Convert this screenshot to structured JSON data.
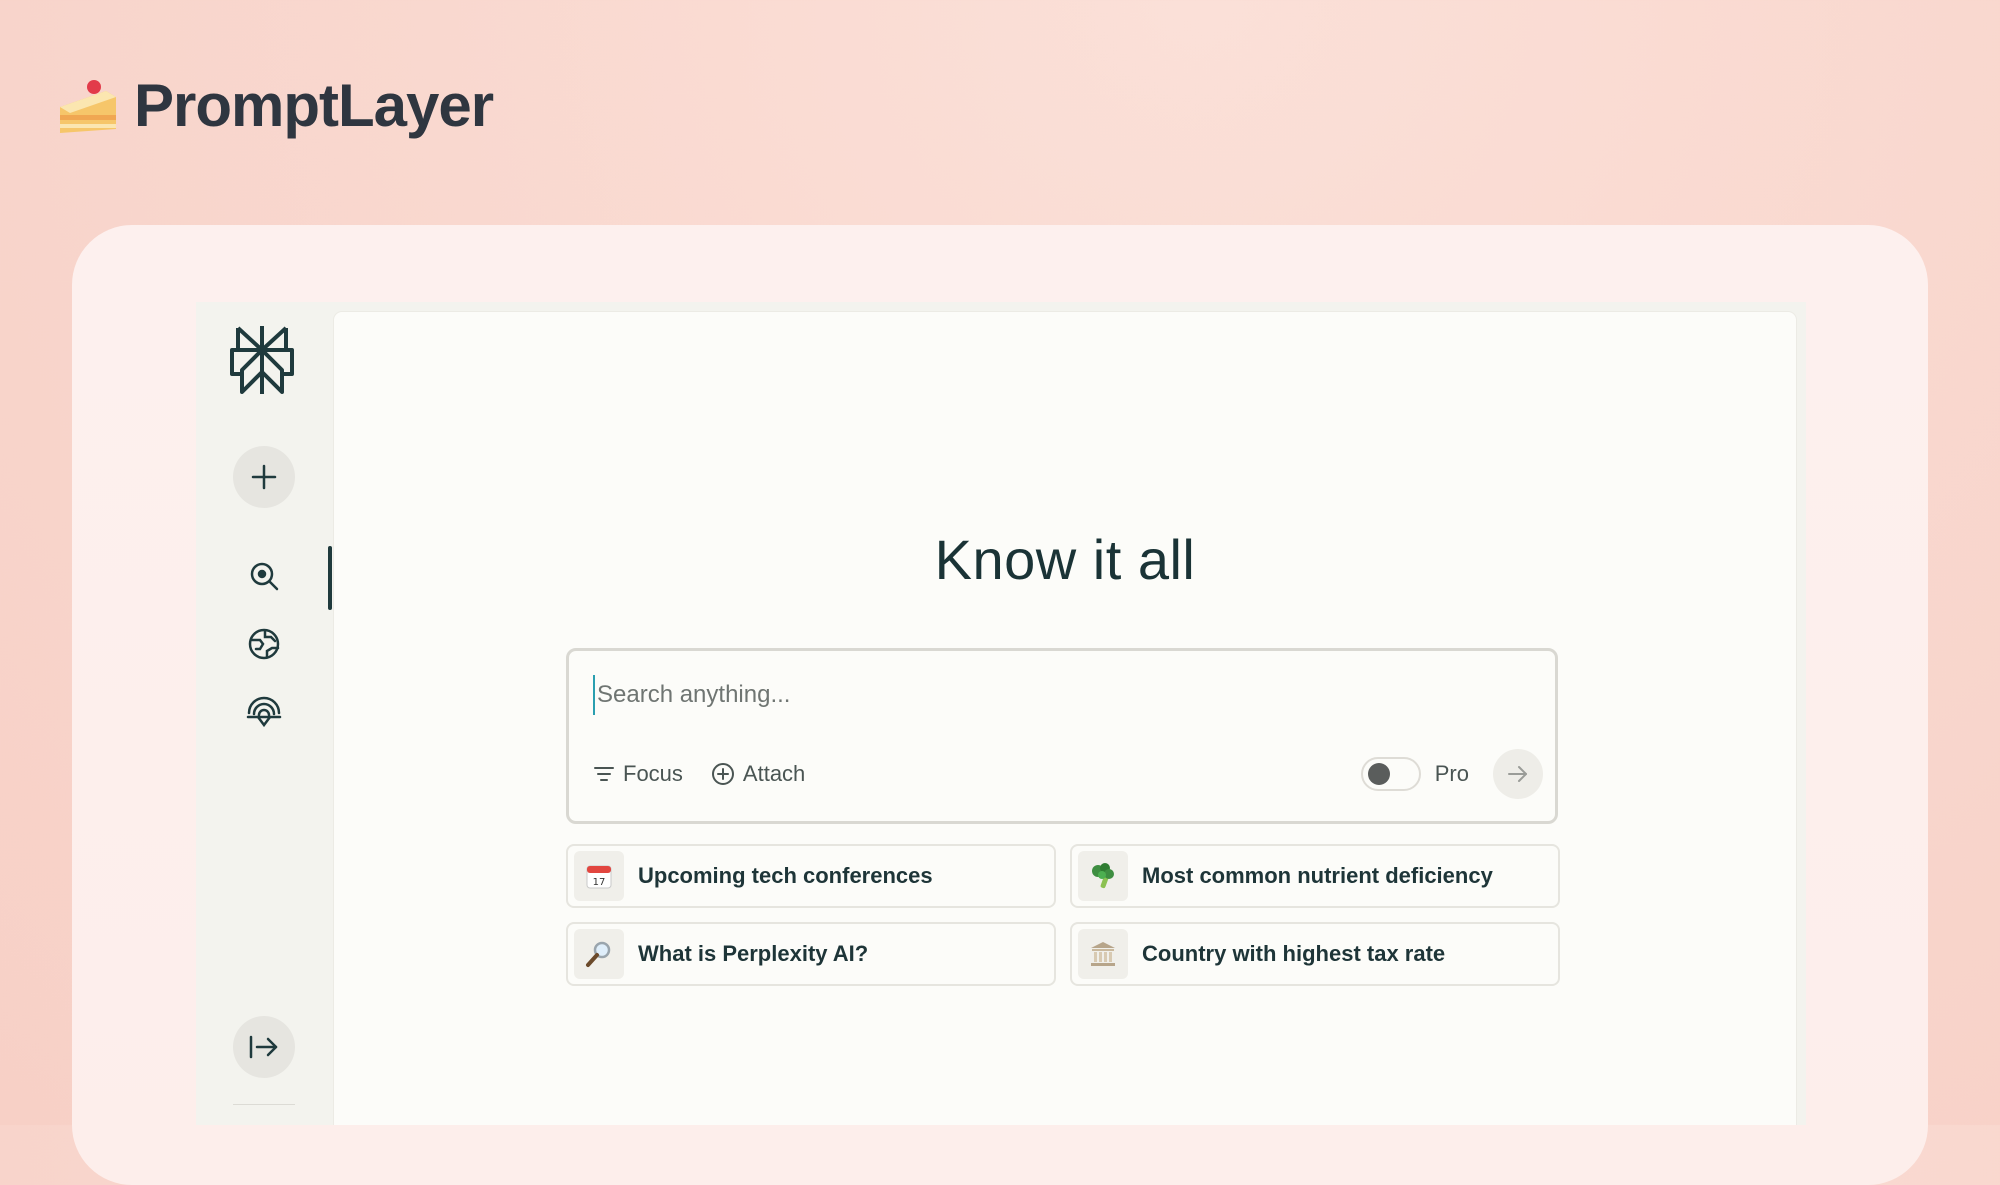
{
  "brand": {
    "name": "PromptLayer"
  },
  "main": {
    "title": "Know it all",
    "search": {
      "placeholder": "Search anything...",
      "focus_label": "Focus",
      "attach_label": "Attach",
      "pro_label": "Pro",
      "pro_enabled": false
    },
    "suggestions": [
      {
        "icon": "calendar-icon",
        "label": "Upcoming tech conferences"
      },
      {
        "icon": "broccoli-icon",
        "label": "Most common nutrient deficiency"
      },
      {
        "icon": "magnifier-icon",
        "label": "What is Perplexity AI?"
      },
      {
        "icon": "bank-icon",
        "label": "Country with highest tax rate"
      }
    ]
  },
  "sidebar": {
    "items": [
      {
        "icon": "search-icon",
        "active": true
      },
      {
        "icon": "globe-icon",
        "active": false
      },
      {
        "icon": "library-icon",
        "active": false
      }
    ]
  },
  "colors": {
    "accent": "#1f3a3d",
    "background": "#f9d8cf",
    "panel": "#fcfcf9"
  }
}
